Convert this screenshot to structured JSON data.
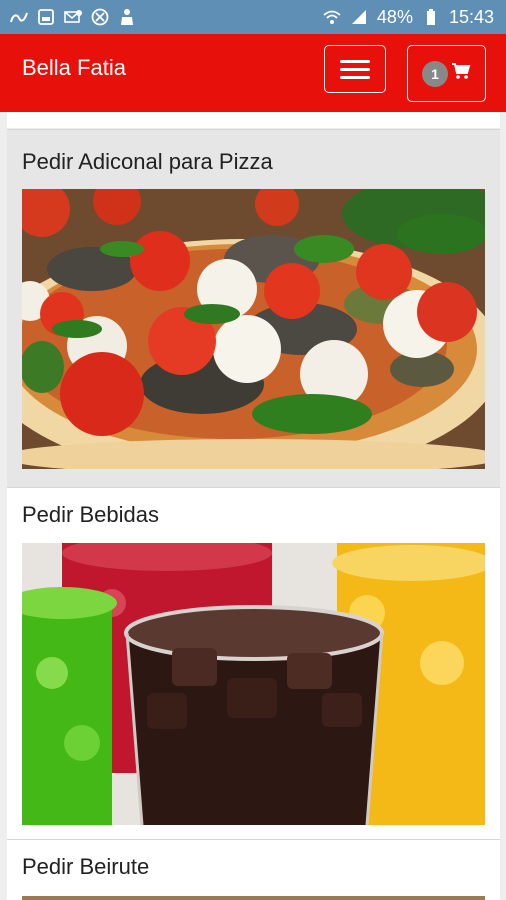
{
  "status_bar": {
    "battery": "48%",
    "time": "15:43"
  },
  "navbar": {
    "brand": "Bella Fatia",
    "cart_count": "1"
  },
  "cards": [
    {
      "title": "Pedir Adiconal para Pizza"
    },
    {
      "title": "Pedir Bebidas"
    },
    {
      "title": "Pedir Beirute"
    }
  ],
  "colors": {
    "navbar": "#e8100a",
    "status_bar": "#5f8fb4",
    "badge": "#888888"
  }
}
